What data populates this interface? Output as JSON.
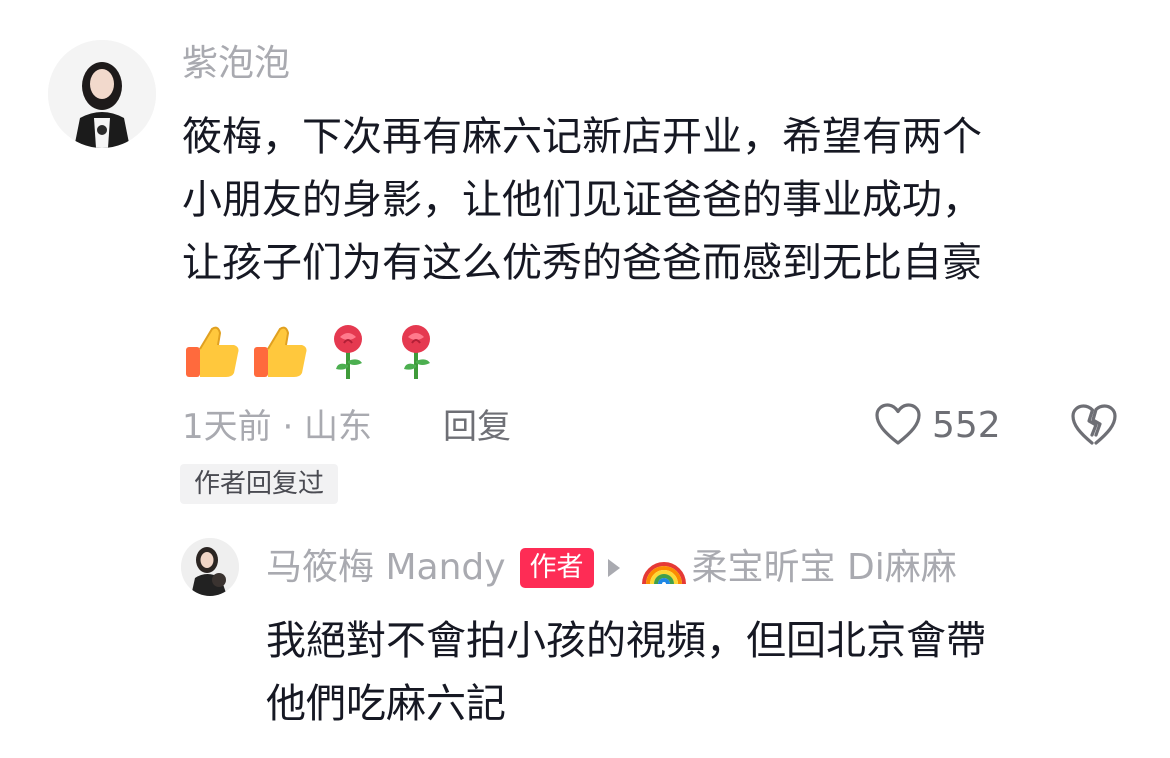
{
  "comment": {
    "author": "紫泡泡",
    "text": "筱梅，下次再有麻六记新店开业，希望有两个\n小朋友的身影，让他们见证爸爸的事业成功，\n让孩子们为有这么优秀的爸爸而感到无比自豪",
    "emojis": [
      "thumbs-up",
      "thumbs-up",
      "rose",
      "rose"
    ],
    "time_location": "1天前 · 山东",
    "reply_label": "回复",
    "like_count": "552",
    "author_replied_tag": "作者回复过"
  },
  "reply": {
    "author": "马筱梅 Mandy",
    "author_badge": "作者",
    "reply_to": "柔宝昕宝 Di麻麻",
    "text": "我絕對不會拍小孩的視頻，但回北京會帶\n他們吃麻六記"
  },
  "colors": {
    "primary_text": "#161823",
    "secondary_text": "#a9aab0",
    "accent": "#fe2c55"
  }
}
